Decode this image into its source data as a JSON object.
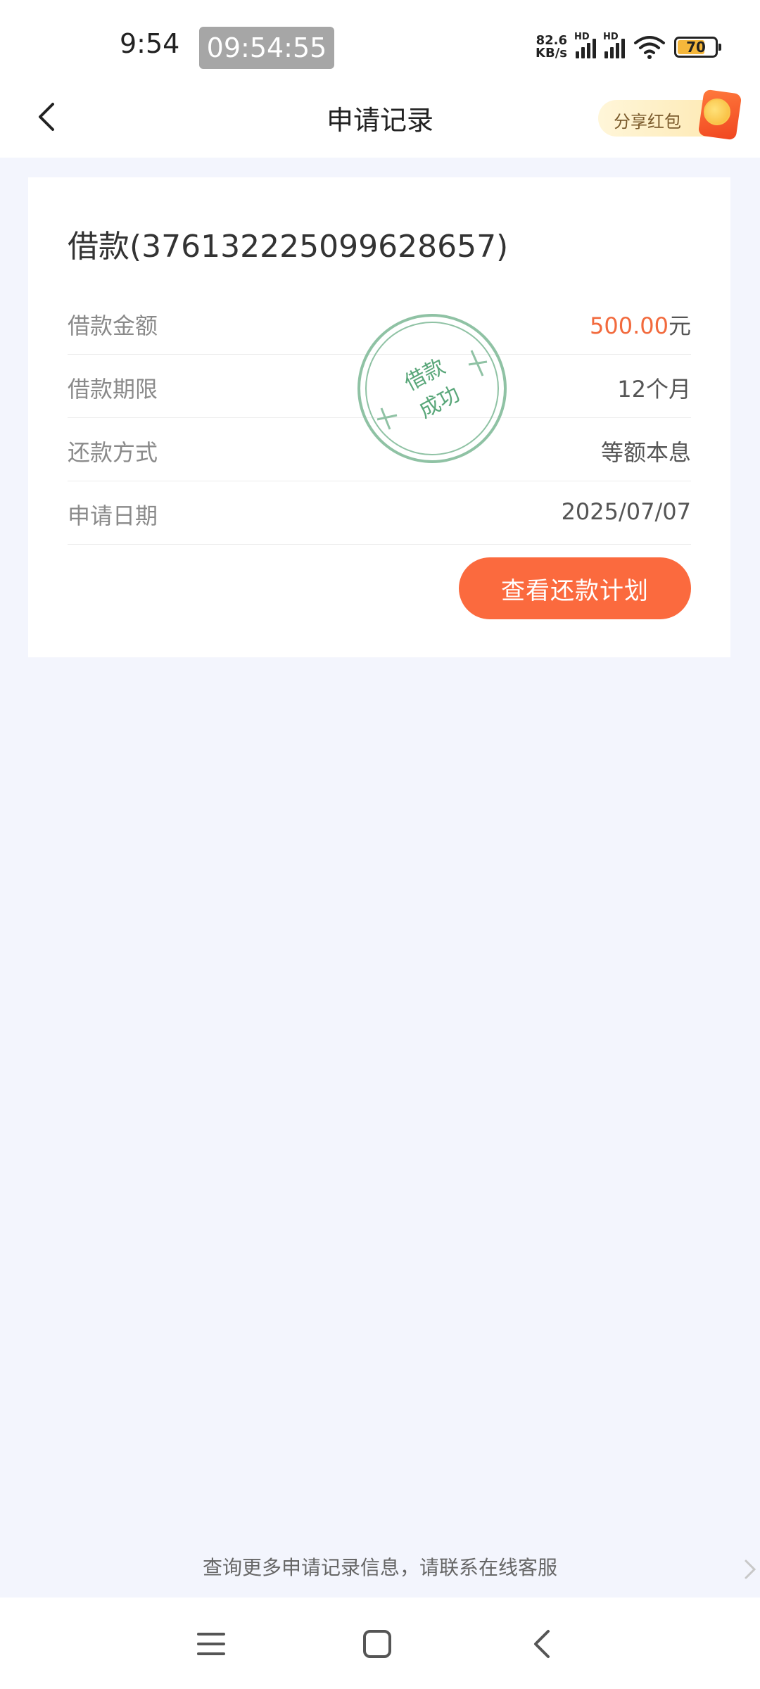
{
  "status_bar": {
    "time": "9:54",
    "recorder_time": "09:54:55",
    "net_speed_value": "82.6",
    "net_speed_unit": "KB/s",
    "hd_label_1": "HD",
    "hd_label_2": "HD",
    "battery_level": "70"
  },
  "header": {
    "title": "申请记录",
    "share_label": "分享红包"
  },
  "loan_card": {
    "title": "借款(37613222509962865​7)",
    "rows": [
      {
        "label": "借款金额",
        "value_amount": "500.00",
        "value_unit": "元"
      },
      {
        "label": "借款期限",
        "value": "12个月"
      },
      {
        "label": "还款方式",
        "value": "等额本息"
      },
      {
        "label": "申请日期",
        "value": "2025/07/07"
      }
    ],
    "stamp_text_1": "借款",
    "stamp_text_2": "成功",
    "button_label": "查看还款计划"
  },
  "footer": {
    "note": "查询更多申请记录信息，请联系在线客服"
  },
  "colors": {
    "accent": "#fb6a3e",
    "amount": "#f26a3d",
    "stamp": "#5aa77a",
    "background": "#f3f5fd"
  }
}
